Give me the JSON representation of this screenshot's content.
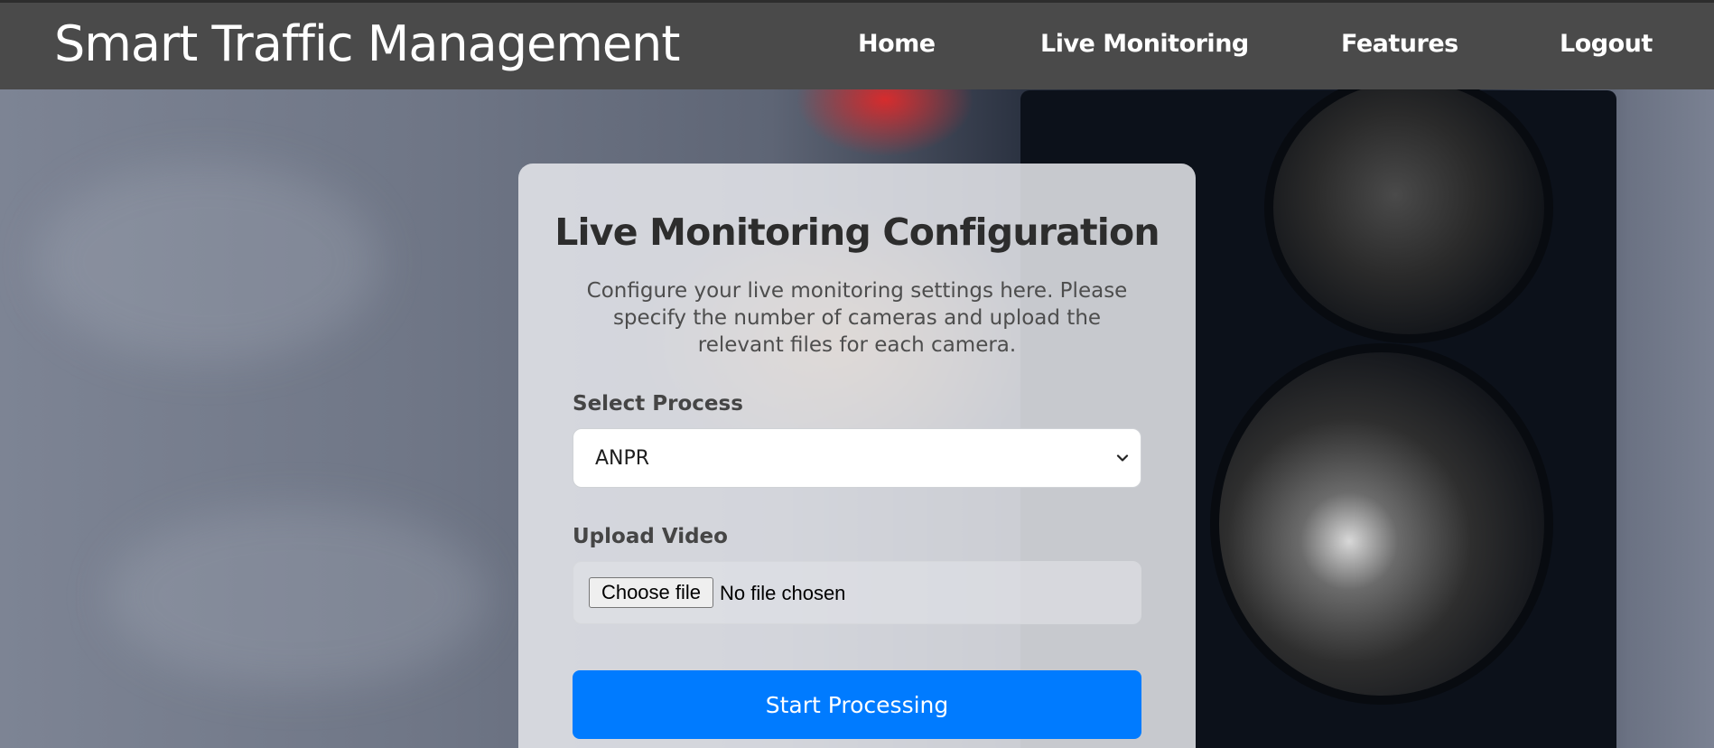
{
  "navbar": {
    "brand": "Smart Traffic Management",
    "links": [
      "Home",
      "Live Monitoring",
      "Features",
      "Logout"
    ]
  },
  "card": {
    "title": "Live Monitoring Configuration",
    "description": "Configure your live monitoring settings here. Please specify the number of cameras and upload the relevant files for each camera.",
    "process": {
      "label": "Select Process",
      "selected": "ANPR",
      "icon": "chevron-down-icon"
    },
    "upload": {
      "label": "Upload Video",
      "button_label": "Choose file",
      "status": "No file chosen"
    },
    "submit_label": "Start Processing"
  },
  "colors": {
    "navbar_bg": "#4a4a4a",
    "primary_button": "#007bff",
    "card_bg": "#e6e8ec"
  }
}
